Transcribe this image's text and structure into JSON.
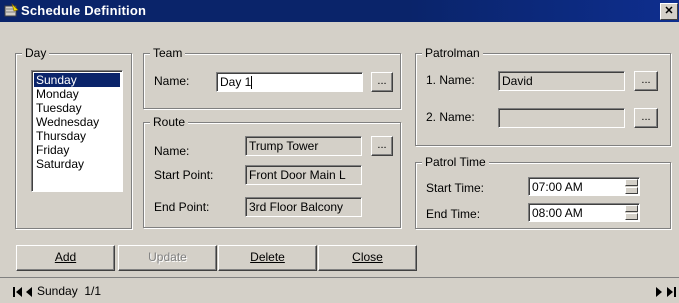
{
  "window": {
    "title": "Schedule Definition"
  },
  "day_group": {
    "legend": "Day",
    "items": [
      {
        "label": "Sunday",
        "selected": true
      },
      {
        "label": "Monday",
        "selected": false
      },
      {
        "label": "Tuesday",
        "selected": false
      },
      {
        "label": "Wednesday",
        "selected": false
      },
      {
        "label": "Thursday",
        "selected": false
      },
      {
        "label": "Friday",
        "selected": false
      },
      {
        "label": "Saturday",
        "selected": false
      }
    ]
  },
  "team_group": {
    "legend": "Team",
    "name_label": "Name:",
    "name_value": "Day 1",
    "browse_label": "..."
  },
  "route_group": {
    "legend": "Route",
    "name_label": "Name:",
    "name_value": "Trump Tower",
    "start_label": "Start Point:",
    "start_value": "Front Door Main L",
    "end_label": "End Point:",
    "end_value": "3rd Floor Balcony",
    "browse_label": "..."
  },
  "patrolman_group": {
    "legend": "Patrolman",
    "name1_label": "1. Name:",
    "name1_value": "David",
    "name2_label": "2. Name:",
    "name2_value": "",
    "browse_label": "..."
  },
  "patrol_time_group": {
    "legend": "Patrol Time",
    "start_label": "Start Time:",
    "start_value": "07:00 AM",
    "end_label": "End Time:",
    "end_value": "08:00 AM"
  },
  "buttons": {
    "add": "Add",
    "update": "Update",
    "delete": "Delete",
    "close": "Close"
  },
  "status": {
    "record_text": "Sunday  1/1"
  },
  "colors": {
    "face": "#d4d0c8",
    "title": "#0a246a",
    "selection": "#0a246a"
  }
}
